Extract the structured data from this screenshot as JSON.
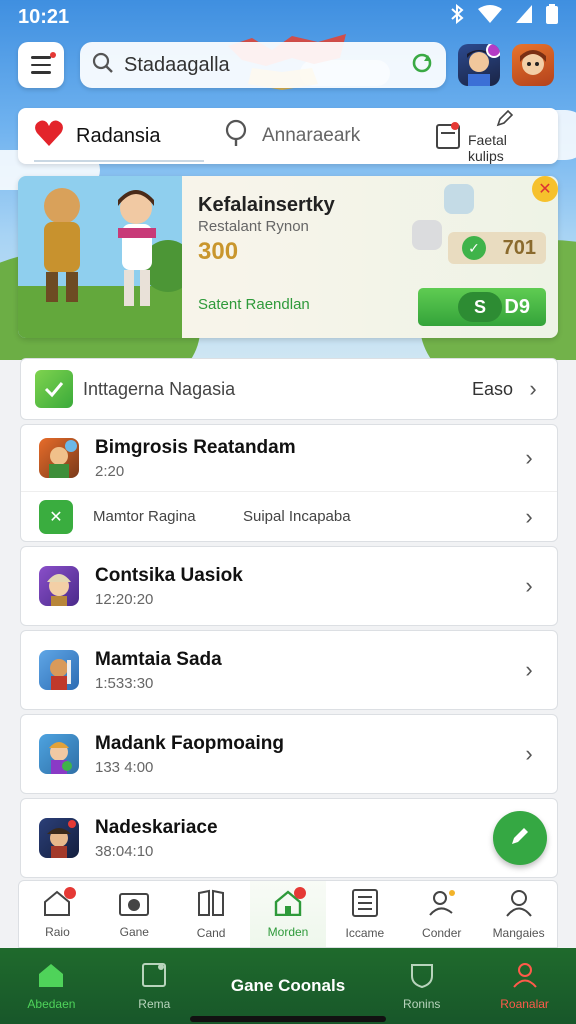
{
  "status": {
    "time": "10:21"
  },
  "search": {
    "text": "Stadaagalla"
  },
  "tabs": [
    {
      "label": "Radansia"
    },
    {
      "label": "Annaraeark"
    },
    {
      "label": "Faetal kulips"
    }
  ],
  "promo": {
    "title": "Kefalainsertky",
    "subtitle": "Restalant Rynon",
    "price": "300",
    "link": "Satent Raendlan",
    "chip_value": "701",
    "button_left": "S",
    "button_value": "D9"
  },
  "list_header": {
    "label": "Inttagerna Nagasia",
    "right": "Easo"
  },
  "items": [
    {
      "title": "Bimgrosis Reatandam",
      "time": "2:20"
    },
    {
      "title": "Contsika Uasiok",
      "time": "12:20:20"
    },
    {
      "title": "Mamtaia Sada",
      "time": "1:533:30"
    },
    {
      "title": "Madank Faopmoaing",
      "time": "133 4:00"
    },
    {
      "title": "Nadeskariace",
      "time": "38:04:10"
    }
  ],
  "sub_row": {
    "left": "Mamtor Ragina",
    "right": "Suipal Incapaba"
  },
  "bottom_tabs": [
    {
      "label": "Raio"
    },
    {
      "label": "Gane"
    },
    {
      "label": "Cand"
    },
    {
      "label": "Morden"
    },
    {
      "label": "Iccame"
    },
    {
      "label": "Conder"
    },
    {
      "label": "Mangaies"
    }
  ],
  "bottom_nav": [
    {
      "label": "Abedaen"
    },
    {
      "label": "Rema"
    },
    {
      "label": "Gane Coonals"
    },
    {
      "label": "Ronins"
    },
    {
      "label": "Roanalar"
    }
  ],
  "colors": {
    "accent_green": "#35a843",
    "nav_bg": "#1f6a2c",
    "promo_price": "#c9962d",
    "alert_red": "#e53935"
  }
}
